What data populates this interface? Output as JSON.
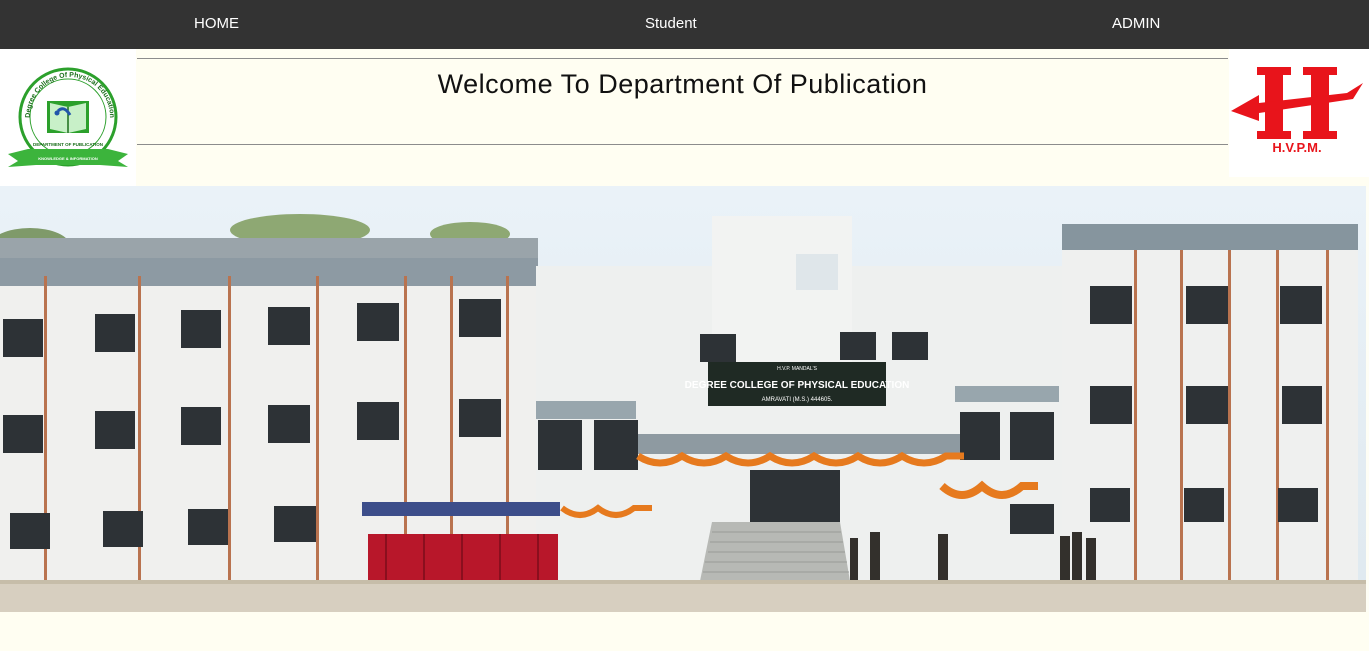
{
  "nav": {
    "home_label": "HOME",
    "student_label": "Student",
    "admin_label": "ADMIN"
  },
  "header": {
    "title": "Welcome To Department Of Publication",
    "left_logo": {
      "arc_text": "Degree College Of Physical Education",
      "sub_text": "Amravati (M.S.)",
      "ribbon_text": "DEPARTMENT OF PUBLICATION",
      "motto_text": "KNOWLEDGE & INFORMATION",
      "icon": "book-logo-icon"
    },
    "right_logo": {
      "letter": "H",
      "text": "H.V.P.M.",
      "icon": "hvpm-logo-icon"
    }
  },
  "banner": {
    "sign_line1": "H.V.P. MANDAL'S",
    "sign_line2": "DEGREE COLLEGE OF PHYSICAL EDUCATION",
    "sign_line3": "AMRAVATI (M.S.) 444605."
  },
  "colors": {
    "navbar": "#333333",
    "page_bg": "#fefef5",
    "hvpm_red": "#e8141b",
    "logo_green": "#2ca02c"
  }
}
